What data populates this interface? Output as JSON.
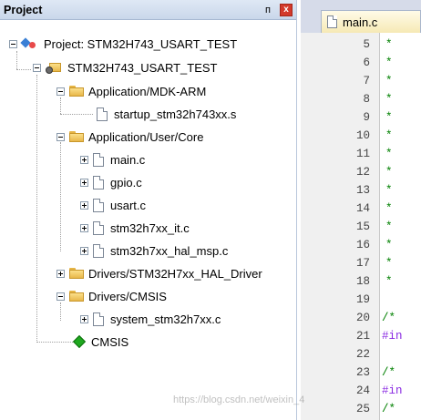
{
  "panel": {
    "title": "Project",
    "pin_glyph": "ᴨ",
    "close_glyph": "x"
  },
  "tree": {
    "project": "Project: STM32H743_USART_TEST",
    "target": "STM32H743_USART_TEST",
    "groups": [
      {
        "label": "Application/MDK-ARM",
        "files": [
          "startup_stm32h743xx.s"
        ]
      },
      {
        "label": "Application/User/Core",
        "files": [
          "main.c",
          "gpio.c",
          "usart.c",
          "stm32h7xx_it.c",
          "stm32h7xx_hal_msp.c"
        ]
      },
      {
        "label": "Drivers/STM32H7xx_HAL_Driver",
        "files": []
      },
      {
        "label": "Drivers/CMSIS",
        "files": [
          "system_stm32h7xx.c"
        ]
      }
    ],
    "cmsis": "CMSIS"
  },
  "editor": {
    "tab": "main.c",
    "lines": [
      "5",
      "6",
      "7",
      "8",
      "9",
      "10",
      "11",
      "12",
      "13",
      "14",
      "15",
      "16",
      "17",
      "18",
      "19",
      "20",
      "21",
      "22",
      "23",
      "24",
      "25"
    ],
    "code": [
      "*",
      "*",
      "*",
      "*",
      "*",
      "*",
      "*",
      "*",
      "*",
      "*",
      "*",
      "*",
      "*",
      "*",
      "",
      "/*",
      "#in",
      "",
      "/*",
      "#in",
      "/*"
    ]
  },
  "watermark": "https://blog.csdn.net/weixin_4"
}
